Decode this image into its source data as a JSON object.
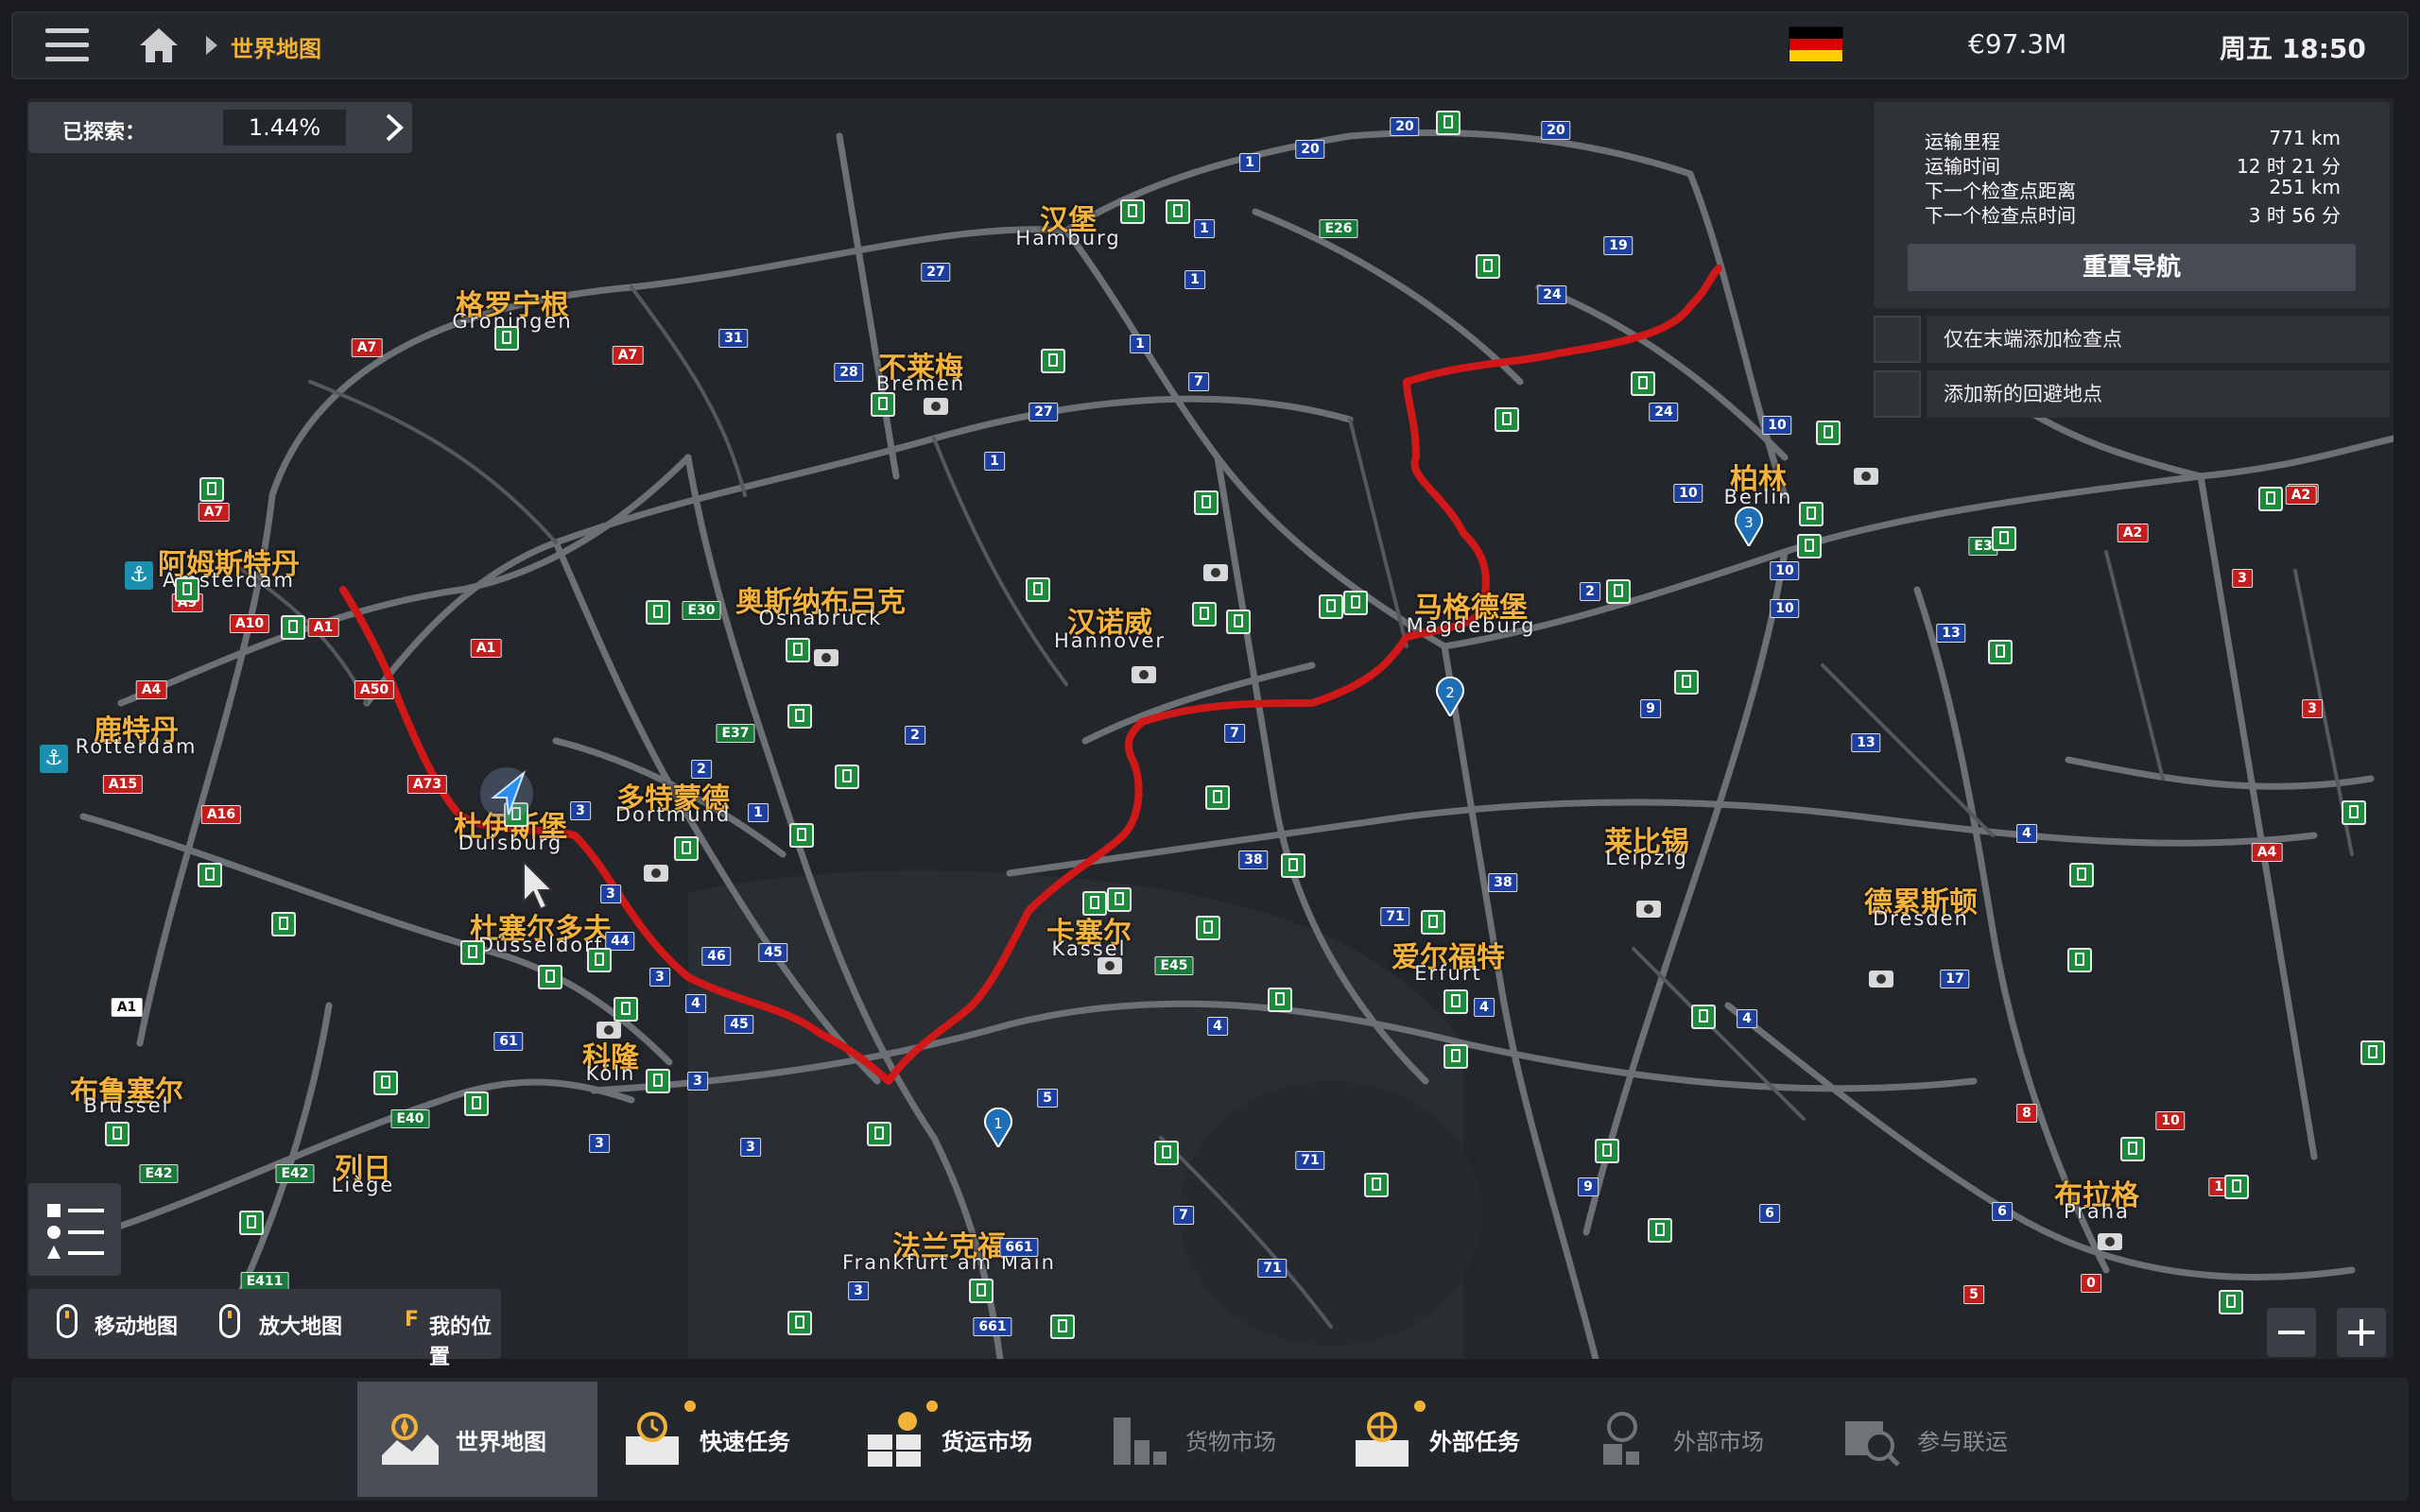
{
  "topbar": {
    "breadcrumb": "世界地图",
    "money": "€97.3M",
    "time": "周五 18:50",
    "flag_colors": [
      "#000000",
      "#dd0000",
      "#ffce00"
    ]
  },
  "explored": {
    "label": "已探索：",
    "value": "1.44%"
  },
  "navigation": {
    "rows": [
      {
        "key": "运输里程",
        "value": "771 km"
      },
      {
        "key": "运输时间",
        "value": "12 时 21 分"
      },
      {
        "key": "下一个检查点距离",
        "value": "251 km"
      },
      {
        "key": "下一个检查点时间",
        "value": "3 时 56 分"
      }
    ],
    "reset_label": "重置导航",
    "option_end_checkpoint": "仅在末端添加检查点",
    "option_avoid_point": "添加新的回避地点"
  },
  "cities": [
    {
      "cn": "汉堡",
      "en": "Hamburg"
    },
    {
      "cn": "格罗宁根",
      "en": "Groningen"
    },
    {
      "cn": "不莱梅",
      "en": "Bremen"
    },
    {
      "cn": "阿姆斯特丹",
      "en": "Amsterdam"
    },
    {
      "cn": "奥斯纳布吕克",
      "en": "Osnabrück"
    },
    {
      "cn": "汉诺威",
      "en": "Hannover"
    },
    {
      "cn": "马格德堡",
      "en": "Magdeburg"
    },
    {
      "cn": "柏林",
      "en": "Berlin"
    },
    {
      "cn": "鹿特丹",
      "en": "Rotterdam"
    },
    {
      "cn": "杜伊斯堡",
      "en": "Duisburg"
    },
    {
      "cn": "多特蒙德",
      "en": "Dortmund"
    },
    {
      "cn": "莱比锡",
      "en": "Leipzig"
    },
    {
      "cn": "德累斯顿",
      "en": "Dresden"
    },
    {
      "cn": "杜塞尔多夫",
      "en": "Düsseldorf"
    },
    {
      "cn": "卡塞尔",
      "en": "Kassel"
    },
    {
      "cn": "爱尔福特",
      "en": "Erfurt"
    },
    {
      "cn": "科隆",
      "en": "Köln"
    },
    {
      "cn": "布鲁塞尔",
      "en": "Brussel"
    },
    {
      "cn": "列日",
      "en": "Liège"
    },
    {
      "cn": "法兰克福",
      "en": "Frankfurt am Main"
    },
    {
      "cn": "布拉格",
      "en": "Praha"
    }
  ],
  "road_labels": [
    "20",
    "20",
    "20",
    "1",
    "E26",
    "1",
    "19",
    "27",
    "31",
    "28",
    "1",
    "27",
    "1",
    "7",
    "24",
    "24",
    "10",
    "A7",
    "A7",
    "A7",
    "1",
    "A9",
    "A10",
    "A1",
    "A1",
    "A4",
    "A50",
    "E30",
    "2",
    "E37",
    "2",
    "1",
    "A15",
    "A16",
    "A73",
    "3",
    "3",
    "44",
    "46",
    "45",
    "3",
    "4",
    "45",
    "3",
    "61",
    "A1",
    "E40",
    "E42",
    "E42",
    "E411",
    "3",
    "3",
    "5",
    "38",
    "7",
    "7",
    "9",
    "13",
    "10",
    "10",
    "2",
    "10",
    "E3",
    "A2",
    "A2",
    "3",
    "3",
    "A4",
    "4",
    "4",
    "4",
    "71",
    "E45",
    "4",
    "71",
    "71",
    "9",
    "6",
    "6",
    "8",
    "10",
    "11",
    "0",
    "5",
    "3",
    "661",
    "661",
    "38",
    "17",
    "13",
    "A2"
  ],
  "route_pins": [
    "1",
    "2",
    "3"
  ],
  "hints": {
    "move": "移动地图",
    "zoom": "放大地图",
    "fkey": "F",
    "mypos": "我的位置"
  },
  "tabs": [
    {
      "label": "世界地图"
    },
    {
      "label": "快速任务"
    },
    {
      "label": "货运市场"
    },
    {
      "label": "货物市场"
    },
    {
      "label": "外部任务"
    },
    {
      "label": "外部市场"
    },
    {
      "label": "参与联运"
    }
  ],
  "colors": {
    "accent": "#f2b23a",
    "route": "#d01818",
    "road": "#6d7176",
    "station": "#1b8a3a"
  }
}
